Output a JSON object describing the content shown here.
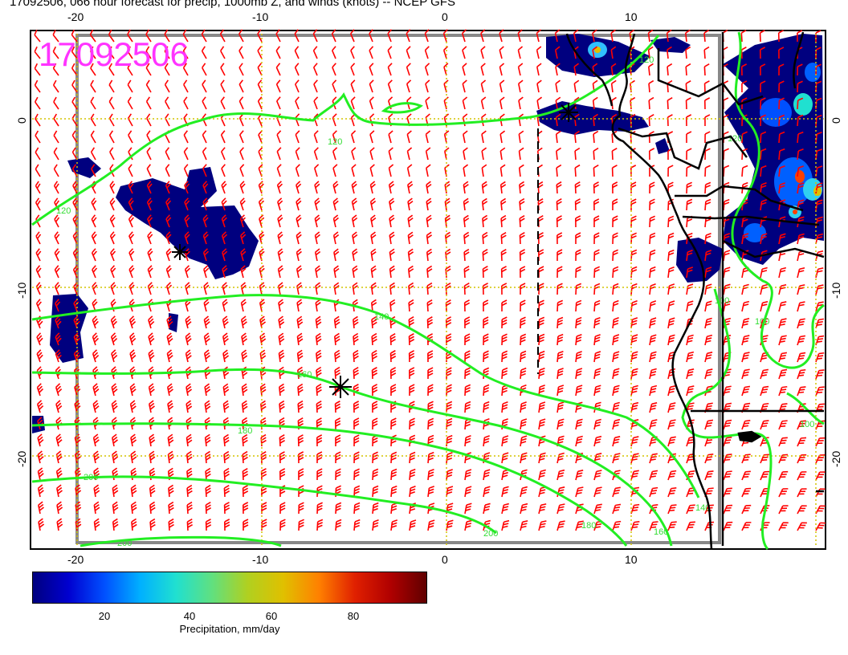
{
  "title": "17092506, 066 hour forecast for precip, 1000mb Z, and winds (knots) -- NCEP GFS",
  "stamp": "17092506",
  "axes": {
    "lon_ticks": [
      "-20",
      "-10",
      "0",
      "10"
    ],
    "lat_ticks": [
      "0",
      "-10",
      "-20"
    ]
  },
  "contour_labels": [
    "120",
    "120",
    "120",
    "120",
    "140",
    "160",
    "180",
    "200",
    "200",
    "140",
    "160",
    "180",
    "200",
    "100",
    "100",
    "100"
  ],
  "colorbar": {
    "label": "Precipitation, mm/day",
    "ticks": [
      "20",
      "40",
      "60",
      "80"
    ],
    "colors": [
      "#00007f",
      "#0000d0",
      "#0050ff",
      "#00b0ff",
      "#20e0d0",
      "#60e080",
      "#b0d020",
      "#e0c000",
      "#ff8000",
      "#e02000",
      "#b00000",
      "#600000"
    ]
  },
  "colors": {
    "wind_barb": "#ff0000",
    "contour": "#22ee22",
    "precip_low": "#000080",
    "grid": "#d4c400",
    "stamp": "#ff33ff"
  },
  "markers": [
    "storm-marker",
    "storm-marker",
    "storm-marker"
  ]
}
